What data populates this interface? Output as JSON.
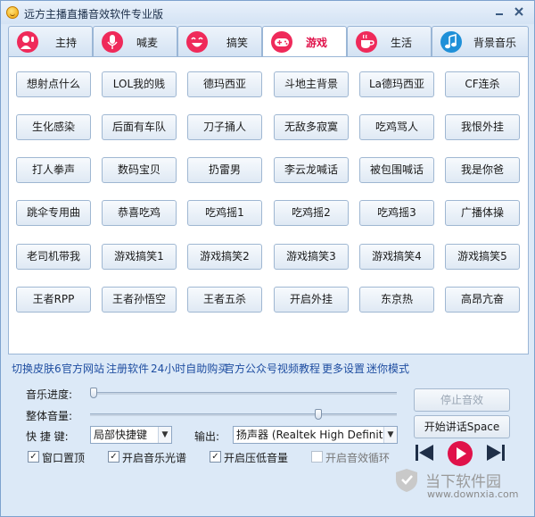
{
  "window": {
    "title": "远方主播直播音效软件专业版"
  },
  "tabs": [
    {
      "label": "主持",
      "icon": "microphone-person-icon",
      "color": "#e0124a"
    },
    {
      "label": "喊麦",
      "icon": "microphone-icon",
      "color": "#e0124a"
    },
    {
      "label": "搞笑",
      "icon": "laughing-face-icon",
      "color": "#e0124a"
    },
    {
      "label": "游戏",
      "icon": "gamepad-icon",
      "color": "#e0124a",
      "active": true
    },
    {
      "label": "生活",
      "icon": "coffee-cup-icon",
      "color": "#e0124a"
    },
    {
      "label": "背景音乐",
      "icon": "music-note-icon",
      "color": "#1f90d8"
    }
  ],
  "sound_buttons": [
    [
      "想射点什么",
      "LOL我的贱",
      "德玛西亚",
      "斗地主背景",
      "La德玛西亚",
      "CF连杀"
    ],
    [
      "生化感染",
      "后面有车队",
      "刀子捅人",
      "无敌多寂寞",
      "吃鸡骂人",
      "我恨外挂"
    ],
    [
      "打人拳声",
      "数码宝贝",
      "扔雷男",
      "李云龙喊话",
      "被包围喊话",
      "我是你爸"
    ],
    [
      "跳伞专用曲",
      "恭喜吃鸡",
      "吃鸡摇1",
      "吃鸡摇2",
      "吃鸡摇3",
      "广播体操"
    ],
    [
      "老司机带我",
      "游戏搞笑1",
      "游戏搞笑2",
      "游戏搞笑3",
      "游戏搞笑4",
      "游戏搞笑5"
    ],
    [
      "王者RPP",
      "王者孙悟空",
      "王者五杀",
      "开启外挂",
      "东京热",
      "高昂亢奋"
    ]
  ],
  "links": [
    "切换皮肤6",
    "官方网站",
    "注册软件",
    "24小时自助购买",
    "官方公众号",
    "视频教程",
    "更多设置",
    "迷你模式"
  ],
  "controls": {
    "music_progress_label": "音乐进度:",
    "music_progress_value": 0.0,
    "volume_label": "整体音量:",
    "volume_value": 0.75,
    "hotkey_label": "快 捷 键:",
    "hotkey_value": "局部快捷键",
    "output_label": "输出:",
    "output_value": "扬声器 (Realtek High Definition Audio)",
    "stop_button": "停止音效",
    "talk_button": "开始讲话Space",
    "checkboxes": [
      {
        "label": "窗口置顶",
        "checked": true
      },
      {
        "label": "开启音乐光谱",
        "checked": true
      },
      {
        "label": "开启压低音量",
        "checked": true
      },
      {
        "label": "开启音效循环",
        "checked": false
      }
    ]
  },
  "watermark": {
    "brand": "当下软件园",
    "url": "www.downxia.com"
  },
  "colors": {
    "accent": "#e0124a",
    "link": "#1f4ea1",
    "play": "#e0124a"
  }
}
